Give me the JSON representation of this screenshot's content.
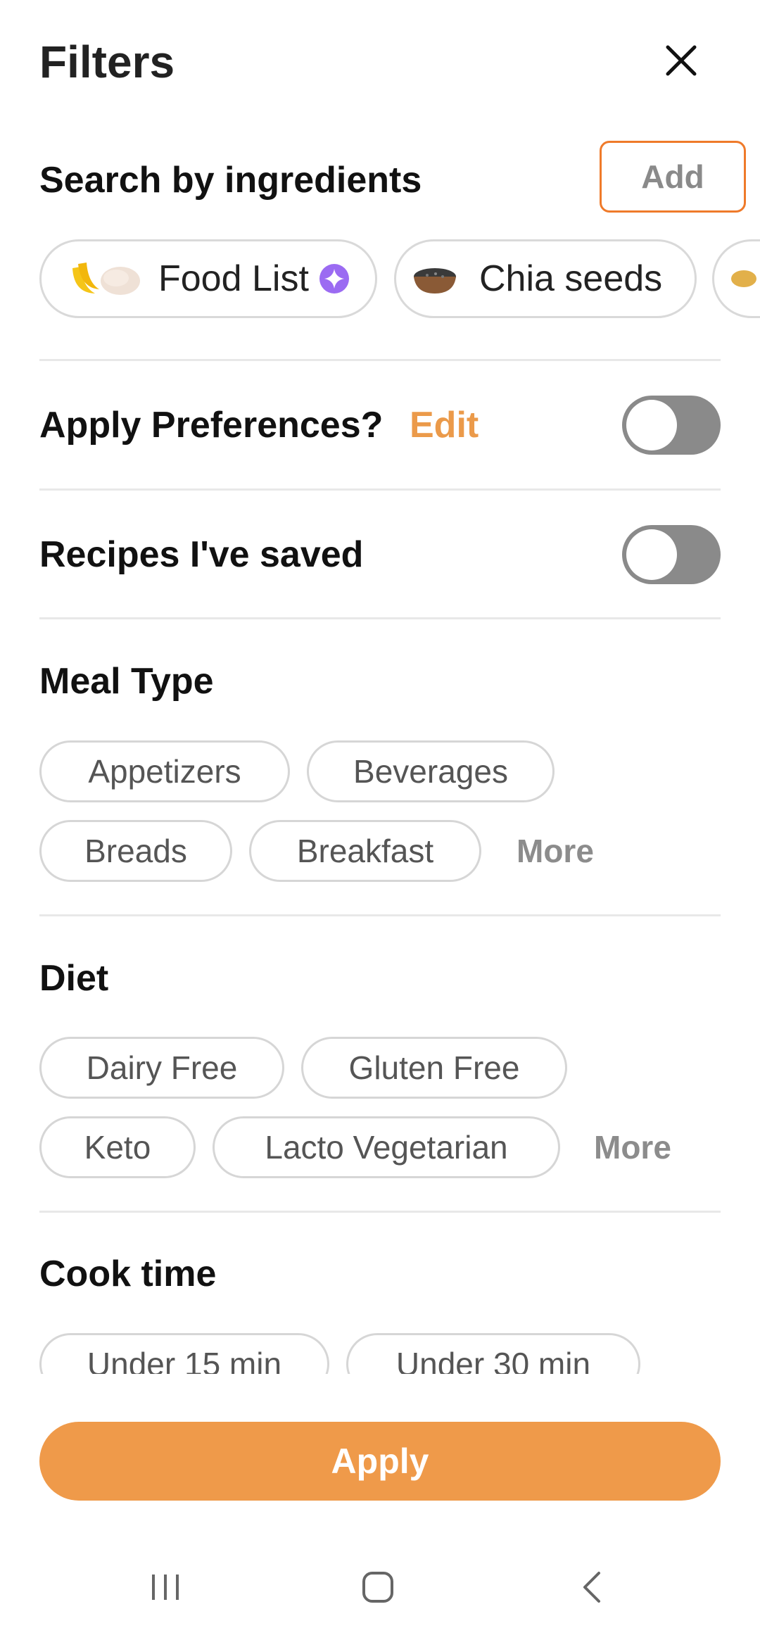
{
  "header": {
    "title": "Filters"
  },
  "ingredients": {
    "section_title": "Search by ingredients",
    "add_label": "Add",
    "chips": [
      {
        "label": "Food List",
        "icon": "banana-chicken-icon",
        "badge": "sparkle-icon"
      },
      {
        "label": "Chia seeds",
        "icon": "chia-bowl-icon"
      },
      {
        "label": "",
        "icon": "potato-icon"
      }
    ]
  },
  "preferences": {
    "label": "Apply Preferences?",
    "edit_label": "Edit",
    "enabled": false
  },
  "saved": {
    "label": "Recipes I've saved",
    "enabled": false
  },
  "meal_type": {
    "title": "Meal Type",
    "options": [
      "Appetizers",
      "Beverages",
      "Breads",
      "Breakfast"
    ],
    "more_label": "More"
  },
  "diet": {
    "title": "Diet",
    "options": [
      "Dairy Free",
      "Gluten Free",
      "Keto",
      "Lacto Vegetarian"
    ],
    "more_label": "More"
  },
  "cook_time": {
    "title": "Cook time",
    "options": [
      "Under 15 min",
      "Under 30 min"
    ]
  },
  "footer": {
    "apply_label": "Apply"
  },
  "colors": {
    "accent": "#ef9a4a",
    "add_border": "#ef7a2a",
    "edit_text": "#eb9a4a",
    "sparkle": "#9b6bf2",
    "toggle_off": "#8a8a8a"
  },
  "system_nav": {
    "buttons": [
      "recent-apps-icon",
      "home-icon",
      "back-icon"
    ]
  }
}
